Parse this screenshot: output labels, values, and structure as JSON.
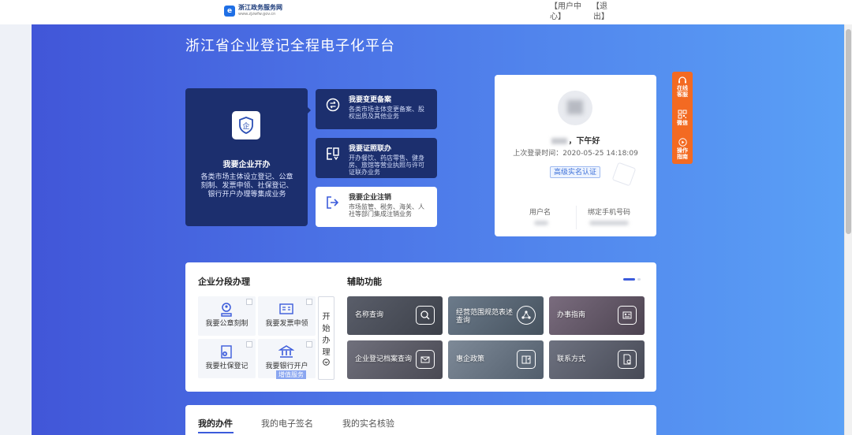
{
  "header": {
    "logo_name": "浙江政务服务网",
    "logo_url": "www.zjzwfw.gov.cn",
    "user_center_line1": "【用户中",
    "user_center_line2": "心】",
    "logout_line1": "【退",
    "logout_line2": "出】"
  },
  "hero": {
    "title": "浙江省企业登记全程电子化平台"
  },
  "cards": {
    "main": {
      "title": "我要企业开办",
      "desc": "各类市场主体设立登记、公章刻制、发票申领、社保登记、银行开户办理等集成业务",
      "icon": "enterprise-shield-icon"
    },
    "change": {
      "title": "我要变更备案",
      "desc": "各类市场主体变更备案、股权出质及其他业务",
      "icon": "change-record-icon"
    },
    "license": {
      "title": "我要证照联办",
      "desc": "开办餐饮、药店零售、健身房、旅馆等营业执照与许可证联办业务",
      "icon": "license-link-icon"
    },
    "cancel": {
      "title": "我要企业注销",
      "desc": "市场监管、税务、海关、人社等部门集成注销业务",
      "icon": "logout-arrow-icon"
    }
  },
  "user": {
    "greeting": "，下午好",
    "last_login": "上次登录时间：2020-05-25 14:18:09",
    "auth_badge": "高级实名认证",
    "username_label": "用户名",
    "phone_label": "绑定手机号码"
  },
  "float_bar": [
    {
      "label_1": "在线",
      "label_2": "客服",
      "icon": "headset-icon"
    },
    {
      "label_1": "",
      "label_2": "微信",
      "icon": "qrcode-icon"
    },
    {
      "label_1": "操作",
      "label_2": "指南",
      "icon": "play-circle-icon"
    }
  ],
  "staged": {
    "title": "企业分段办理",
    "items": [
      {
        "label": "我要公章刻制",
        "icon": "seal-icon"
      },
      {
        "label": "我要发票申领",
        "icon": "invoice-icon"
      },
      {
        "label": "我要社保登记",
        "icon": "social-insurance-icon"
      },
      {
        "label": "我要银行开户",
        "icon": "bank-icon"
      }
    ],
    "tag": "增值服务",
    "start_chars": [
      "开",
      "始",
      "办",
      "理"
    ]
  },
  "aux": {
    "title": "辅助功能",
    "items": [
      {
        "label": "名称查询",
        "icon": "search-doc-icon",
        "color": "#4a4e5a"
      },
      {
        "label": "经营范围规范表述查询",
        "icon": "scope-network-icon",
        "color": "#5b6a7a"
      },
      {
        "label": "办事指南",
        "icon": "guide-card-icon",
        "color": "#6a5d6e"
      },
      {
        "label": "企业登记档案查询",
        "icon": "archive-mail-icon",
        "color": "#62626d"
      },
      {
        "label": "惠企政策",
        "icon": "policy-book-icon",
        "color": "#6e7a88"
      },
      {
        "label": "联系方式",
        "icon": "contact-doc-icon",
        "color": "#5d6170"
      }
    ]
  },
  "tabs": [
    {
      "label": "我的办件"
    },
    {
      "label": "我的电子签名"
    },
    {
      "label": "我的实名核验"
    }
  ]
}
